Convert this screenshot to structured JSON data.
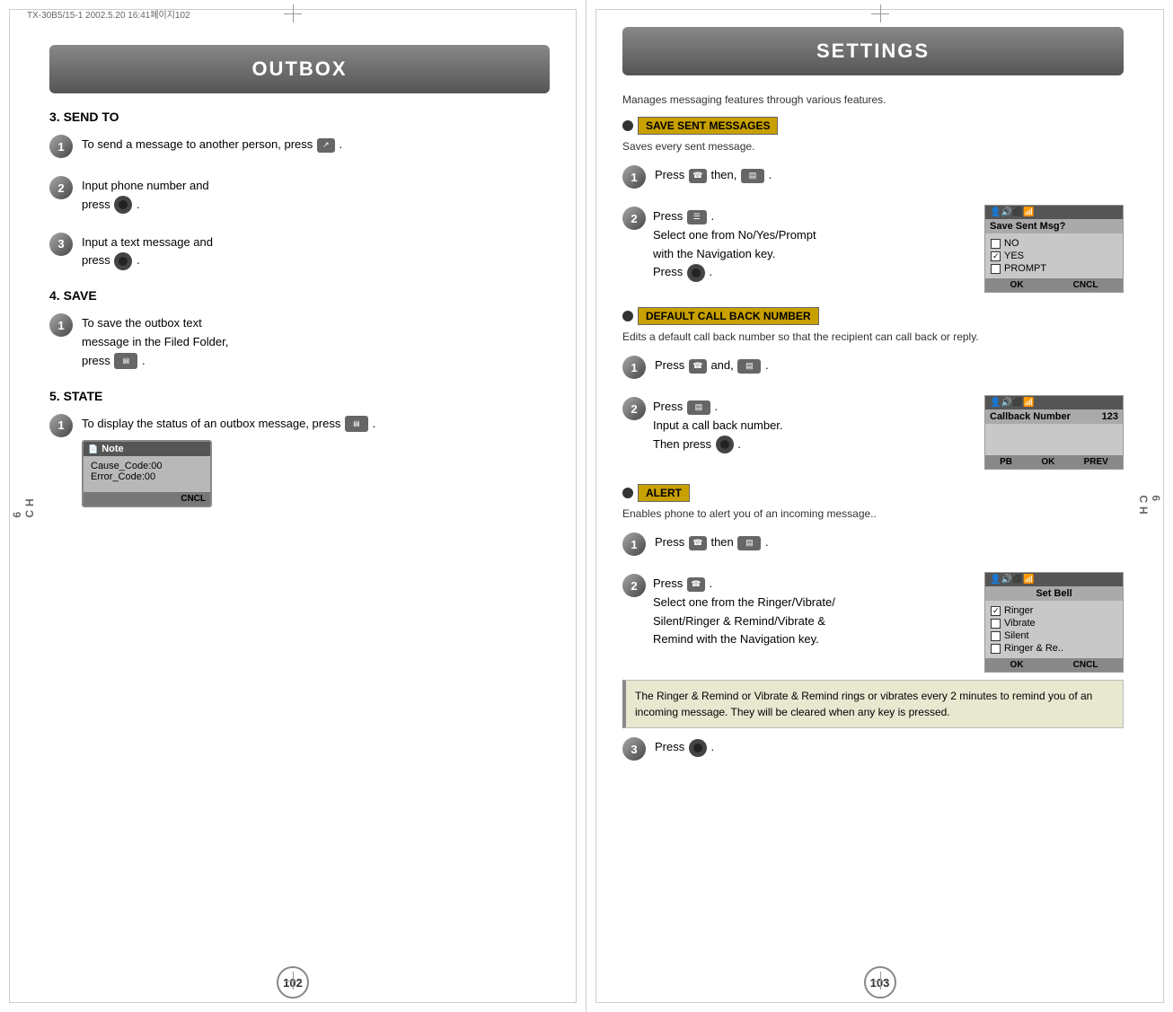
{
  "left": {
    "banner": "OUTBOX",
    "print_info": "TX-30B5/15-1  2002.5.20  16:41페이지102",
    "section3": {
      "title": "3. SEND TO",
      "steps": [
        {
          "num": "1",
          "text": "To send a message to another person, press",
          "icon": "send"
        },
        {
          "num": "2",
          "text": "Input phone number and press",
          "icon": "ok"
        },
        {
          "num": "3",
          "text": "Input a text message and press",
          "icon": "ok"
        }
      ]
    },
    "section4": {
      "title": "4. SAVE",
      "steps": [
        {
          "num": "1",
          "text": "To save the outbox text message in the Filed Folder, press",
          "icon": "menu"
        }
      ]
    },
    "section5": {
      "title": "5. STATE",
      "steps": [
        {
          "num": "1",
          "text": "To display the status of an outbox message, press",
          "icon": "menu",
          "has_screen": true,
          "screen": {
            "title": "Note",
            "rows": [
              "Cause_Code:00",
              "Error_Code:00"
            ],
            "footer": [
              "",
              "CNCL"
            ]
          }
        }
      ]
    },
    "page_number": "102"
  },
  "right": {
    "banner": "SETTINGS",
    "intro": "Manages messaging features through various features.",
    "subsections": [
      {
        "id": "save_sent",
        "title": "SAVE SENT MESSAGES",
        "desc": "Saves every sent message.",
        "steps": [
          {
            "num": "1",
            "text": "Press",
            "icons": [
              "phone",
              "then",
              "menu"
            ],
            "suffix": "then,"
          },
          {
            "num": "2",
            "text": "Press",
            "icon": "nav",
            "detail": "Select one from No/Yes/Prompt with the Navigation key.\nPress",
            "has_screen": true,
            "screen": {
              "title": "Save Sent Msg?",
              "rows": [
                {
                  "checked": false,
                  "label": "NO"
                },
                {
                  "checked": true,
                  "label": "YES"
                },
                {
                  "checked": false,
                  "label": "PROMPT"
                }
              ],
              "footer": [
                "OK",
                "CNCL"
              ]
            }
          }
        ]
      },
      {
        "id": "default_callback",
        "title": "DEFAULT CALL BACK NUMBER",
        "desc": "Edits a default call back number so that the recipient can call back or reply.",
        "steps": [
          {
            "num": "1",
            "text": "Press",
            "suffix": "and,"
          },
          {
            "num": "2",
            "text": "Press",
            "detail": "Input a call back number.\nThen press",
            "has_screen": true,
            "screen": {
              "title": "Callback Number",
              "value": "123",
              "rows": [],
              "footer": [
                "PB",
                "OK",
                "PREV"
              ]
            }
          }
        ]
      },
      {
        "id": "alert",
        "title": "ALERT",
        "desc": "Enables phone to alert you of an incoming message..",
        "steps": [
          {
            "num": "1",
            "text": "Press",
            "suffix": "then"
          },
          {
            "num": "2",
            "text": "Press",
            "detail": "Select one from the Ringer/Vibrate/Silent/Ringer & Remind/Vibrate & Remind with the Navigation key.",
            "has_screen": true,
            "screen": {
              "title": "Set Bell",
              "rows": [
                {
                  "checked": true,
                  "label": "Ringer"
                },
                {
                  "checked": false,
                  "label": "Vibrate"
                },
                {
                  "checked": false,
                  "label": "Silent"
                },
                {
                  "checked": false,
                  "label": "Ringer & Re.."
                }
              ],
              "footer": [
                "OK",
                "CNCL"
              ]
            }
          }
        ],
        "reminder": "The Ringer & Remind or Vibrate & Remind rings or vibrates every 2 minutes to remind you of an incoming message. They will be cleared when any key is pressed.",
        "final_step": {
          "num": "3",
          "text": "Press"
        }
      }
    ],
    "page_number": "103"
  },
  "icons": {
    "phone_symbol": "📞",
    "ok_symbol": "●",
    "menu_symbol": "▤",
    "send_symbol": "↗"
  }
}
